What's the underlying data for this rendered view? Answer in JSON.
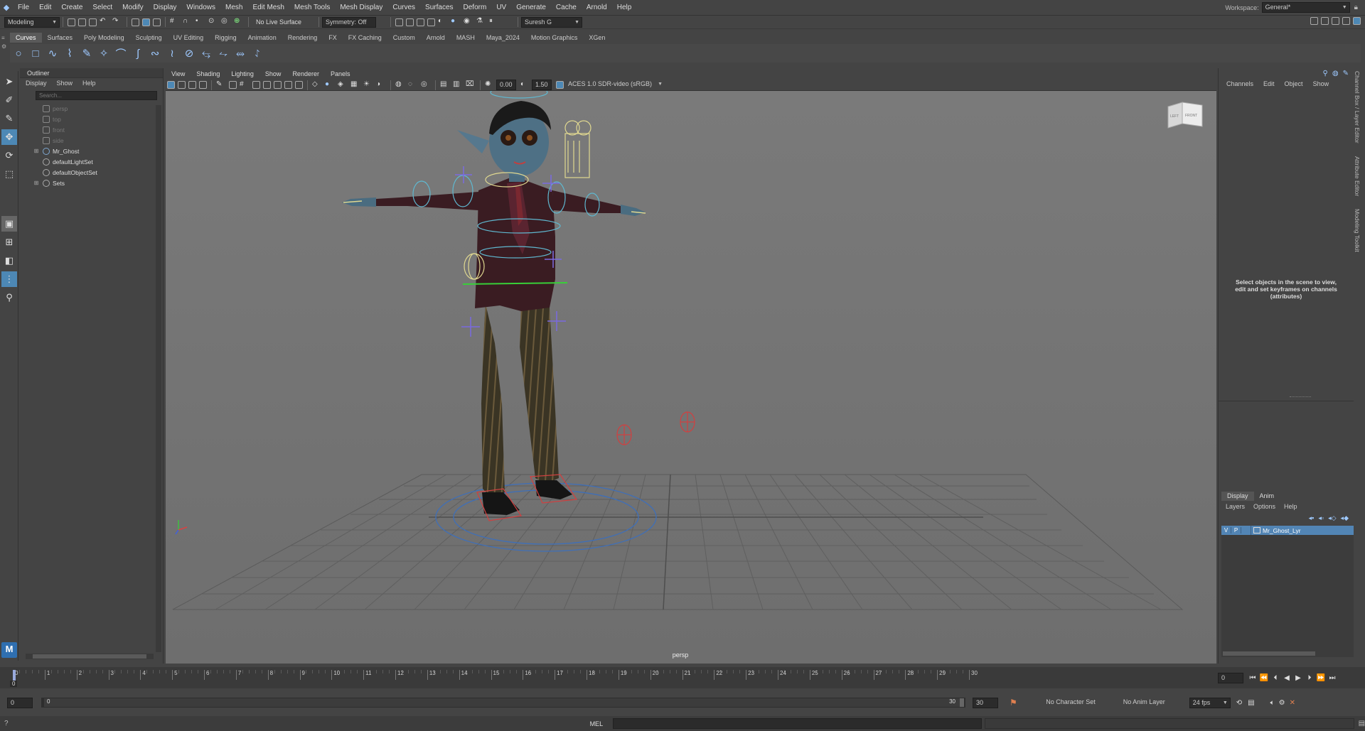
{
  "menubar": {
    "items": [
      "File",
      "Edit",
      "Create",
      "Select",
      "Modify",
      "Display",
      "Windows",
      "Mesh",
      "Edit Mesh",
      "Mesh Tools",
      "Mesh Display",
      "Curves",
      "Surfaces",
      "Deform",
      "UV",
      "Generate",
      "Cache",
      "Arnold",
      "Help"
    ],
    "workspace_label": "Workspace:",
    "workspace_value": "General*"
  },
  "status_line": {
    "mode": "Modeling",
    "live_surface": "No Live Surface",
    "symmetry": "Symmetry: Off",
    "user": "Suresh G"
  },
  "shelf": {
    "tabs": [
      "Curves",
      "Surfaces",
      "Poly Modeling",
      "Sculpting",
      "UV Editing",
      "Rigging",
      "Animation",
      "Rendering",
      "FX",
      "FX Caching",
      "Custom",
      "Arnold",
      "MASH",
      "Maya_2024",
      "Motion Graphics",
      "XGen"
    ],
    "active": "Curves"
  },
  "outliner": {
    "title": "Outliner",
    "menu": [
      "Display",
      "Show",
      "Help"
    ],
    "search_placeholder": "Search...",
    "items": [
      {
        "label": "persp",
        "dim": true,
        "type": "camera"
      },
      {
        "label": "top",
        "dim": true,
        "type": "camera"
      },
      {
        "label": "front",
        "dim": true,
        "type": "camera"
      },
      {
        "label": "side",
        "dim": true,
        "type": "camera"
      },
      {
        "label": "Mr_Ghost",
        "dim": false,
        "type": "group",
        "expand": "+"
      },
      {
        "label": "defaultLightSet",
        "dim": false,
        "type": "set"
      },
      {
        "label": "defaultObjectSet",
        "dim": false,
        "type": "set"
      },
      {
        "label": "Sets",
        "dim": false,
        "type": "set",
        "expand": "+"
      }
    ]
  },
  "viewport": {
    "menu": [
      "View",
      "Shading",
      "Lighting",
      "Show",
      "Renderer",
      "Panels"
    ],
    "exposure": "0.00",
    "gamma": "1.50",
    "color_space": "ACES 1.0 SDR-video (sRGB)",
    "camera_label": "persp",
    "viewcube_left": "LEFT",
    "viewcube_front": "FRONT"
  },
  "channel_box": {
    "menu": [
      "Channels",
      "Edit",
      "Object",
      "Show"
    ],
    "hint": "Select objects in the scene to view, edit and set keyframes on channels (attributes)"
  },
  "side_tabs": [
    "Channel Box / Layer Editor",
    "Attribute Editor",
    "Modeling Toolkit"
  ],
  "layers": {
    "tabs": [
      "Display",
      "Anim"
    ],
    "menu": [
      "Layers",
      "Options",
      "Help"
    ],
    "layer_name": "Mr_Ghost_Lyr",
    "v": "V",
    "p": "P"
  },
  "time_slider": {
    "ticks": [
      "0",
      "1",
      "2",
      "3",
      "4",
      "5",
      "6",
      "7",
      "8",
      "9",
      "10",
      "11",
      "12",
      "13",
      "14",
      "15",
      "16",
      "17",
      "18",
      "19",
      "20",
      "21",
      "22",
      "23",
      "24",
      "25",
      "26",
      "27",
      "28",
      "29",
      "30"
    ],
    "current_frame": "0",
    "current_left": "0"
  },
  "range_slider": {
    "start": "0",
    "inner_start": "0",
    "inner_end": "30",
    "end": "30",
    "char_set": "No Character Set",
    "anim_layer": "No Anim Layer",
    "fps": "24 fps"
  },
  "command_line": {
    "label": "MEL"
  },
  "colors": {
    "accent": "#4d88b5",
    "layer_highlight": "#5285b5"
  }
}
